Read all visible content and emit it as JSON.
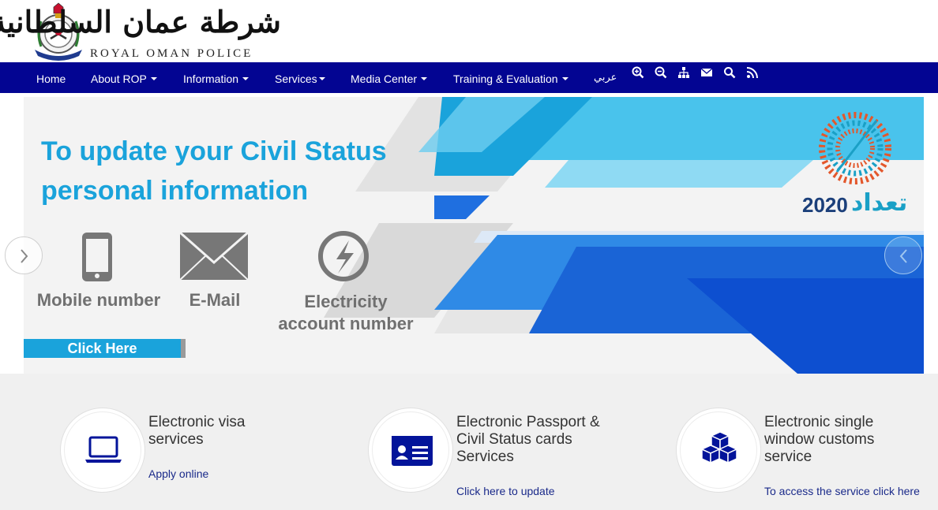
{
  "header": {
    "logo_arabic": "شرطة عمان السلطانية",
    "logo_english": "ROYAL OMAN POLICE"
  },
  "nav": {
    "items": [
      {
        "label": "Home",
        "dropdown": false
      },
      {
        "label": "About ROP",
        "dropdown": true
      },
      {
        "label": "Information",
        "dropdown": true
      },
      {
        "label": "Services",
        "dropdown": true
      },
      {
        "label": "Media Center",
        "dropdown": true
      },
      {
        "label": "Training & Evaluation",
        "dropdown": true
      }
    ],
    "language_link": "عربي",
    "icons": [
      "zoom-in-icon",
      "zoom-out-icon",
      "sitemap-icon",
      "mail-icon",
      "search-icon",
      "rss-icon"
    ]
  },
  "banner": {
    "title_line1": "To update your Civil Status",
    "title_line2": "personal information",
    "items": [
      {
        "label": "Mobile number",
        "icon": "mobile-phone-icon"
      },
      {
        "label": "E-Mail",
        "icon": "envelope-icon"
      },
      {
        "label_line1": "Electricity",
        "label_line2": "account number",
        "icon": "electricity-icon"
      }
    ],
    "click_here": "Click Here",
    "census_year": "2020",
    "census_arabic": "تعداد"
  },
  "services": [
    {
      "title_lines": [
        "Electronic visa",
        "services"
      ],
      "link": "Apply online",
      "icon": "laptop-icon"
    },
    {
      "title_lines": [
        "Electronic Passport &",
        "Civil Status cards",
        "Services"
      ],
      "link": "Click here to update",
      "icon": "id-card-icon"
    },
    {
      "title_lines": [
        "Electronic single",
        "window customs",
        "service"
      ],
      "link": "To access the service click here",
      "icon": "boxes-icon"
    }
  ],
  "colors": {
    "nav_bg": "#030592",
    "accent_cyan": "#1aa3db",
    "link_blue": "#1a2a8a",
    "icon_blue": "#03149a"
  }
}
